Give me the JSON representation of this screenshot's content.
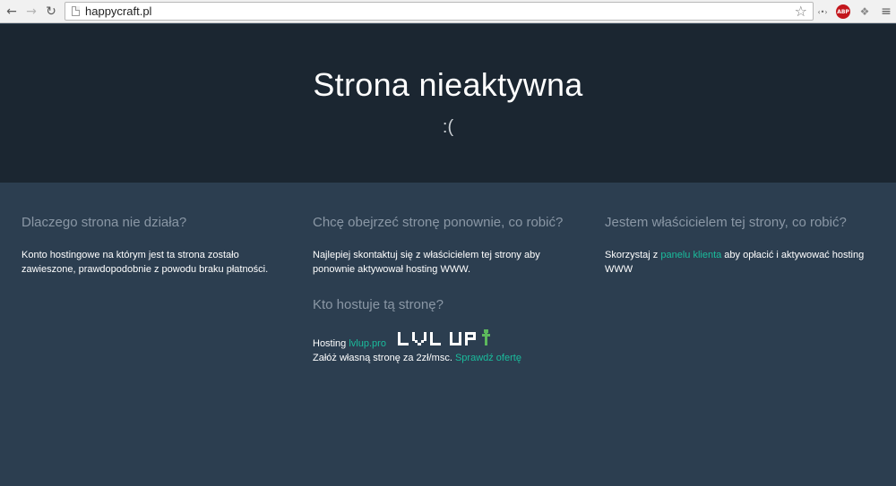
{
  "browser": {
    "url": "happycraft.pl",
    "ext_translate_icon": "translate-icon",
    "ext_abp_label": "ABP",
    "ext_dropbox_icon": "dropbox-icon"
  },
  "hero": {
    "title": "Strona nieaktywna",
    "emoticon": ":("
  },
  "columns": [
    {
      "heading": "Dlaczego strona nie działa?",
      "text": "Konto hostingowe na którym jest ta strona zostało zawieszone, prawdopodobnie z powodu braku płatności."
    },
    {
      "heading": "Chcę obejrzeć stronę ponownie, co robić?",
      "text": "Najlepiej skontaktuj się z właścicielem tej strony aby ponownie aktywował hosting WWW."
    },
    {
      "heading": "Jestem właścicielem tej strony, co robić?",
      "text_before": "Skorzystaj z ",
      "link": "panelu klienta",
      "text_after": " aby opłacić i aktywować hosting WWW"
    }
  ],
  "hosting": {
    "heading": "Kto hostuje tą stronę?",
    "line1_prefix": "Hosting ",
    "line1_link": "lvlup.pro",
    "line2_prefix": "Załóż własną stronę za 2zł/msc. ",
    "line2_link": "Sprawdź ofertę",
    "logo_text": "LVL UP"
  },
  "colors": {
    "hero_bg": "#1b2631",
    "content_bg": "#2c3e50",
    "link": "#1abc9c",
    "heading": "#8a97a5",
    "logo_arrow": "#5cb85c"
  }
}
